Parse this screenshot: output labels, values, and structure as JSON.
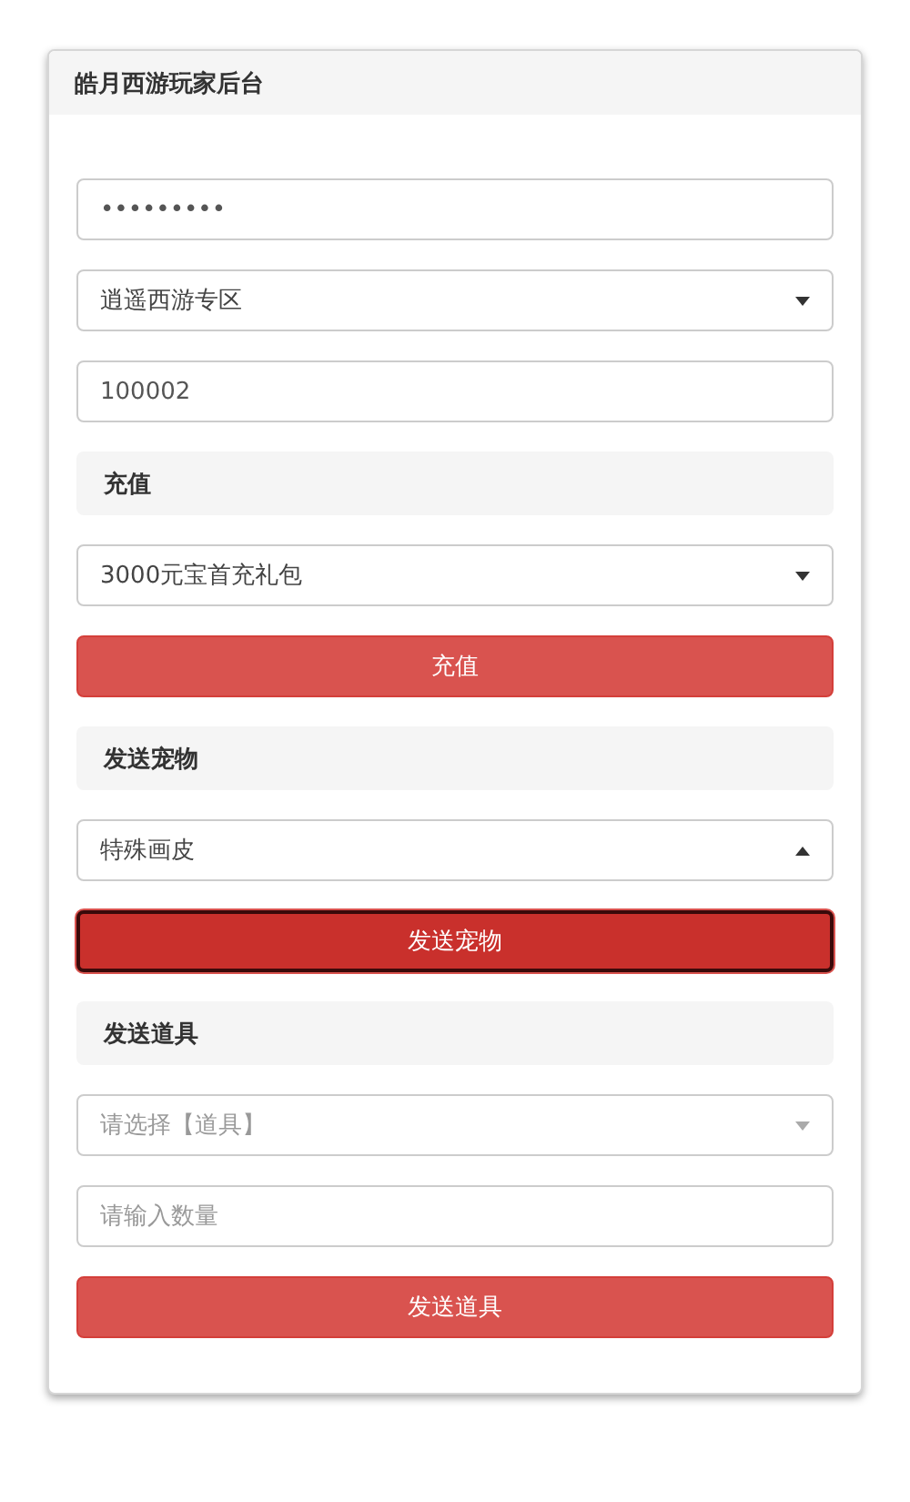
{
  "panel": {
    "title": "皓月西游玩家后台"
  },
  "items": [
    {
      "kind": "password",
      "value": "•••••••••"
    },
    {
      "kind": "select",
      "value": "逍遥西游专区",
      "expanded": false
    },
    {
      "kind": "input",
      "value": "100002"
    },
    {
      "kind": "heading",
      "label": "充值"
    },
    {
      "kind": "select",
      "value": "3000元宝首充礼包",
      "expanded": false
    },
    {
      "kind": "button",
      "label": "充值",
      "focused": false
    },
    {
      "kind": "heading",
      "label": "发送宠物"
    },
    {
      "kind": "select",
      "value": "特殊画皮",
      "expanded": true
    },
    {
      "kind": "button",
      "label": "发送宠物",
      "focused": true
    },
    {
      "kind": "heading",
      "label": "发送道具"
    },
    {
      "kind": "select",
      "placeholder": "请选择【道具】",
      "expanded": false
    },
    {
      "kind": "input",
      "placeholder": "请输入数量"
    },
    {
      "kind": "button",
      "label": "发送道具",
      "focused": false
    }
  ]
}
